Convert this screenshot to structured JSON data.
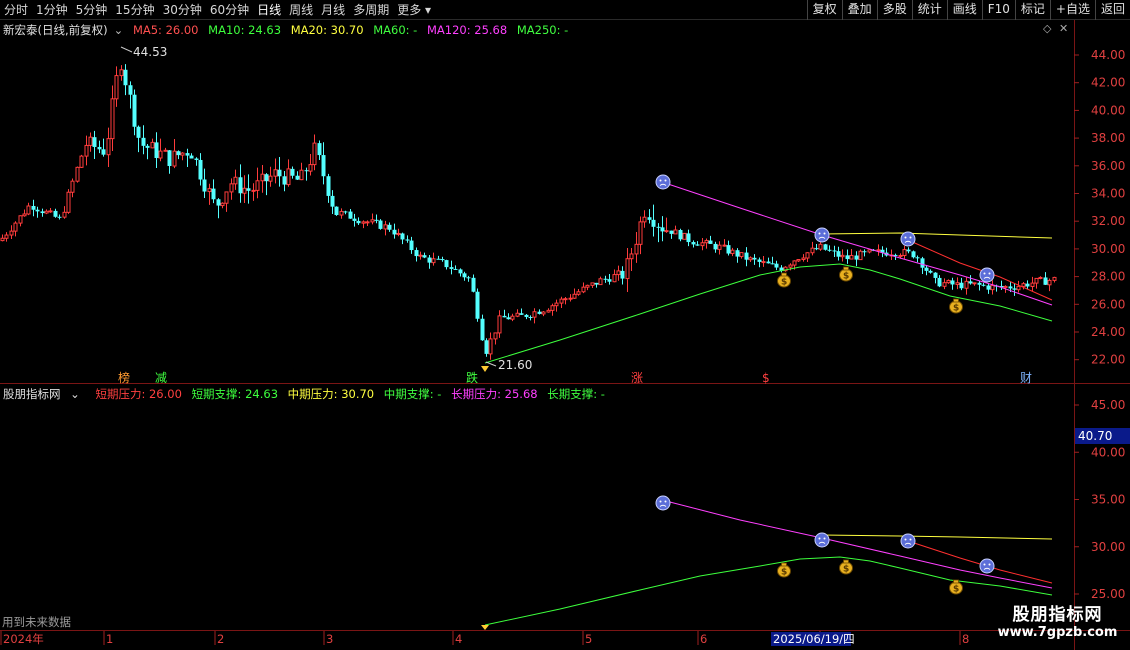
{
  "toolbar": {
    "periods": [
      "分时",
      "1分钟",
      "5分钟",
      "15分钟",
      "30分钟",
      "60分钟",
      "日线",
      "周线",
      "月线",
      "多周期",
      "更多"
    ],
    "active_period": "日线",
    "buttons": [
      "复权",
      "叠加",
      "多股",
      "统计",
      "画线",
      "F10",
      "标记",
      "+自选",
      "返回"
    ]
  },
  "main_legend": {
    "title": "新宏泰(日线,前复权)",
    "items": [
      {
        "text": "MA5: 26.00",
        "color": "#ff5050"
      },
      {
        "text": "MA10: 24.63",
        "color": "#3dff3d"
      },
      {
        "text": "MA20: 30.70",
        "color": "#ffff40"
      },
      {
        "text": "MA60: -",
        "color": "#40ff40"
      },
      {
        "text": "MA120: 25.68",
        "color": "#ff40ff"
      },
      {
        "text": "MA250: -",
        "color": "#40ff40"
      }
    ]
  },
  "indicator_legend": {
    "title": "股朋指标网",
    "items": [
      {
        "text": "短期压力: 26.00",
        "color": "#ff4040"
      },
      {
        "text": "短期支撑: 24.63",
        "color": "#3dff3d"
      },
      {
        "text": "中期压力: 30.70",
        "color": "#ffff40"
      },
      {
        "text": "中期支撑: -",
        "color": "#40ff40"
      },
      {
        "text": "长期压力: 25.68",
        "color": "#ff40ff"
      },
      {
        "text": "长期支撑: -",
        "color": "#40ff40"
      }
    ]
  },
  "price_axis": {
    "ticks": [
      "44.00",
      "42.00",
      "40.00",
      "38.00",
      "36.00",
      "34.00",
      "32.00",
      "30.00",
      "28.00",
      "26.00",
      "24.00",
      "22.00"
    ]
  },
  "indicator_axis": {
    "ticks": [
      "45.00",
      "40.00",
      "35.00",
      "30.00",
      "25.00"
    ],
    "highlight": "40.70"
  },
  "annotations": {
    "high": "44.53",
    "low": "21.60"
  },
  "event_markers": [
    {
      "label": "榜",
      "color": "#ff9a30"
    },
    {
      "label": "减",
      "color": "#40ff40"
    },
    {
      "label": "跌",
      "color": "#40ff40"
    },
    {
      "label": "涨",
      "color": "#ff4040"
    },
    {
      "label": "$",
      "color": "#ff4040"
    },
    {
      "label": "财",
      "color": "#7fb4ff"
    }
  ],
  "time_axis": {
    "labels": [
      "2024年",
      "1",
      "2",
      "3",
      "4",
      "5",
      "6",
      "7",
      "8"
    ],
    "cursor_date": "2025/06/19/四"
  },
  "footer_note": "用到未来数据",
  "watermark": {
    "line1": "股朋指标网",
    "line2": "www.7gpzb.com"
  }
}
